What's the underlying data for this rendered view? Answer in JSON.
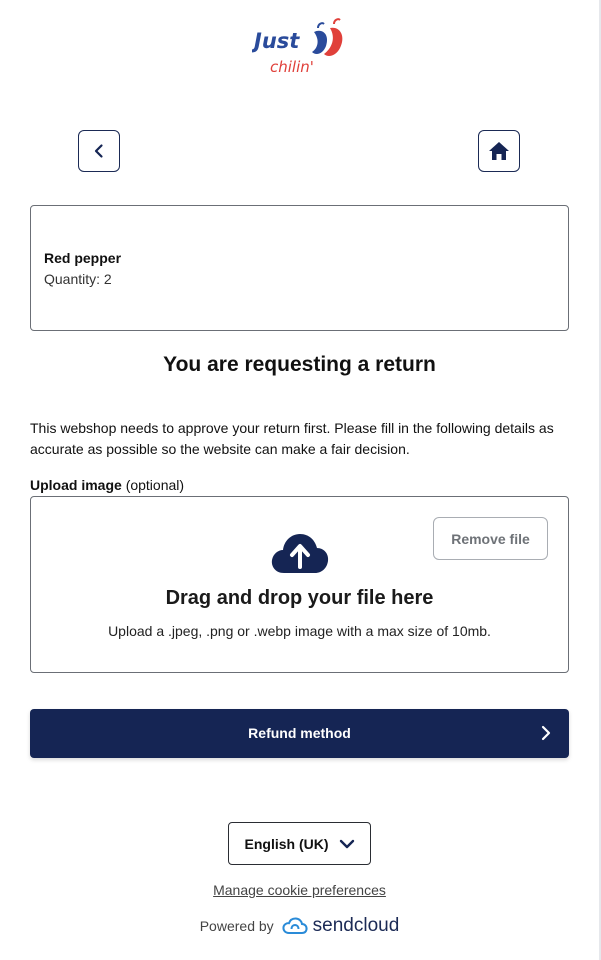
{
  "brand": {
    "logo_line1": "Just",
    "logo_line2": "chilin'",
    "logo_icon": "chili-peppers-icon"
  },
  "nav": {
    "back_icon": "chevron-left-icon",
    "home_icon": "home-icon"
  },
  "product": {
    "name": "Red pepper",
    "quantity": "Quantity: 2"
  },
  "main": {
    "title": "You are requesting a return",
    "description": "This webshop needs to approve your return first. Please fill in the following details as accurate as possible so the website can make a fair decision."
  },
  "upload": {
    "label_bold": "Upload image",
    "label_optional": "(optional)",
    "remove_label": "Remove file",
    "icon": "cloud-upload-icon",
    "title": "Drag and drop your file here",
    "subtitle": "Upload a .jpeg, .png or .webp image with a max size of 10mb."
  },
  "actions": {
    "refund_label": "Refund method",
    "refund_icon": "chevron-right-icon"
  },
  "footer": {
    "language": "English (UK)",
    "language_icon": "chevron-down-icon",
    "cookie_link": "Manage cookie preferences",
    "powered_by": "Powered by",
    "provider": "sendcloud"
  },
  "colors": {
    "primary": "#152554",
    "logo_blue": "#2a4b9b",
    "logo_red": "#e0403a",
    "border": "#6b6f76"
  }
}
